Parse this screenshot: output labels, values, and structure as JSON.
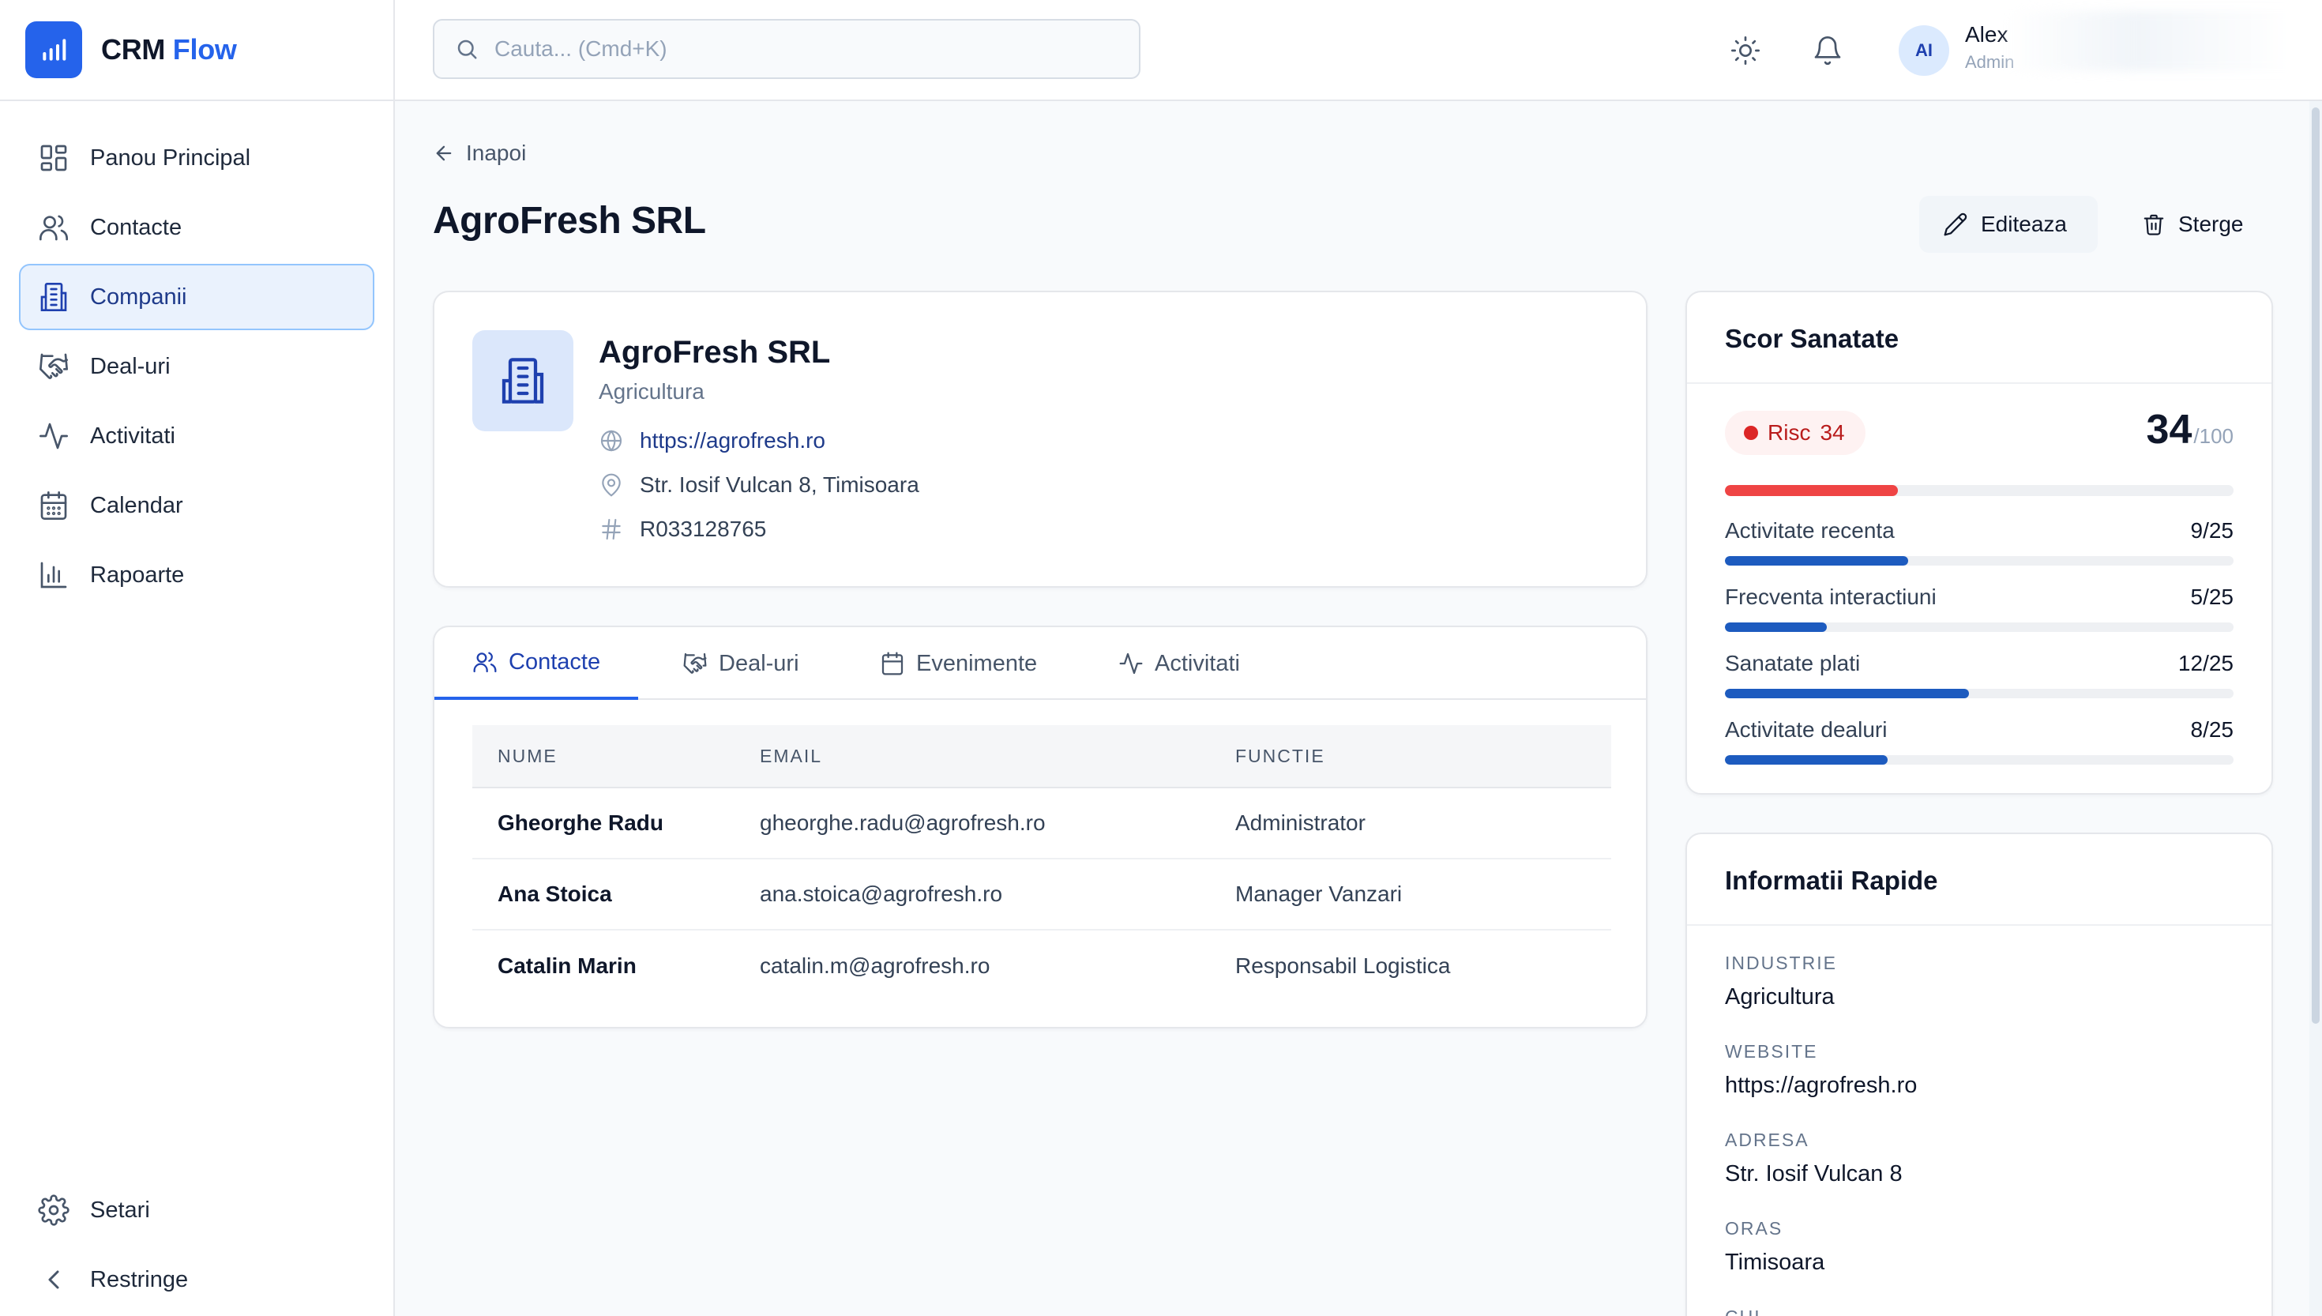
{
  "brand": {
    "name": "CRM",
    "accent": "Flow"
  },
  "sidebar": {
    "items": [
      {
        "label": "Panou Principal",
        "icon": "dashboard-icon"
      },
      {
        "label": "Contacte",
        "icon": "users-icon"
      },
      {
        "label": "Companii",
        "icon": "building-icon",
        "active": true
      },
      {
        "label": "Deal-uri",
        "icon": "handshake-icon"
      },
      {
        "label": "Activitati",
        "icon": "activity-icon"
      },
      {
        "label": "Calendar",
        "icon": "calendar-icon"
      },
      {
        "label": "Rapoarte",
        "icon": "bar-chart-icon"
      }
    ],
    "bottom": [
      {
        "label": "Setari",
        "icon": "gear-icon"
      },
      {
        "label": "Restringe",
        "icon": "chevron-left-icon"
      }
    ]
  },
  "topbar": {
    "search_placeholder": "Cauta... (Cmd+K)",
    "user_initials": "AI",
    "user_name": "Alex",
    "user_role": "Admin"
  },
  "page": {
    "back_label": "Inapoi",
    "title": "AgroFresh SRL",
    "edit_label": "Editeaza",
    "delete_label": "Sterge"
  },
  "company": {
    "name": "AgroFresh SRL",
    "industry": "Agricultura",
    "website": "https://agrofresh.ro",
    "address": "Str. Iosif Vulcan 8, Timisoara",
    "registration": "R033128765"
  },
  "tabs": [
    {
      "label": "Contacte",
      "icon": "users-icon",
      "active": true
    },
    {
      "label": "Deal-uri",
      "icon": "handshake-icon"
    },
    {
      "label": "Evenimente",
      "icon": "calendar-icon"
    },
    {
      "label": "Activitati",
      "icon": "activity-icon"
    }
  ],
  "contacts_table": {
    "headers": [
      "NUME",
      "EMAIL",
      "FUNCTIE"
    ],
    "rows": [
      [
        "Gheorghe Radu",
        "gheorghe.radu@agrofresh.ro",
        "Administrator"
      ],
      [
        "Ana Stoica",
        "ana.stoica@agrofresh.ro",
        "Manager Vanzari"
      ],
      [
        "Catalin Marin",
        "catalin.m@agrofresh.ro",
        "Responsabil Logistica"
      ]
    ]
  },
  "health": {
    "title": "Scor Sanatate",
    "badge_label": "Risc",
    "badge_value": "34",
    "score": "34",
    "score_max": "/100",
    "score_fraction": 0.34,
    "metrics": [
      {
        "label": "Activitate recenta",
        "value": "9/25",
        "fraction": 0.36
      },
      {
        "label": "Frecventa interactiuni",
        "value": "5/25",
        "fraction": 0.2
      },
      {
        "label": "Sanatate plati",
        "value": "12/25",
        "fraction": 0.48
      },
      {
        "label": "Activitate dealuri",
        "value": "8/25",
        "fraction": 0.32
      }
    ]
  },
  "quick_info": {
    "title": "Informatii Rapide",
    "fields": [
      {
        "label": "INDUSTRIE",
        "value": "Agricultura"
      },
      {
        "label": "WEBSITE",
        "value": "https://agrofresh.ro",
        "is_link": true
      },
      {
        "label": "ADRESA",
        "value": "Str. Iosif Vulcan 8"
      },
      {
        "label": "ORAS",
        "value": "Timisoara"
      },
      {
        "label": "CUI",
        "value": ""
      }
    ]
  },
  "colors": {
    "accent": "#2563eb",
    "active_nav_bg": "#eaf2fd",
    "risk": "#dc2626",
    "metric_bar": "#1d5bbf"
  }
}
